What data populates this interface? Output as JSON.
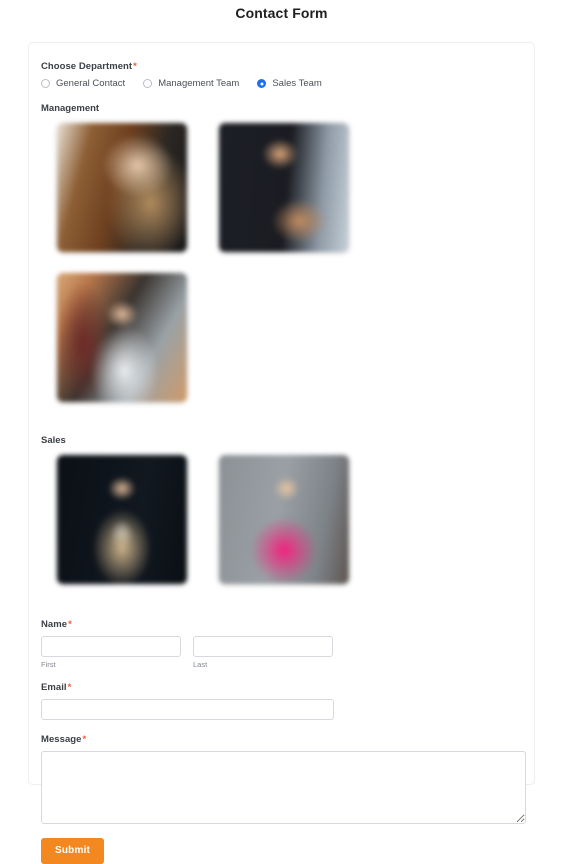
{
  "page": {
    "title": "Contact Form"
  },
  "form": {
    "department": {
      "label": "Choose Department",
      "required_marker": "*",
      "options": [
        {
          "label": "General Contact",
          "selected": false
        },
        {
          "label": "Management Team",
          "selected": false
        },
        {
          "label": "Sales Team",
          "selected": true
        }
      ]
    },
    "groups": [
      {
        "heading": "Management",
        "choices": [
          {
            "caption": "",
            "caption_state": "blurred",
            "photo": "ph1"
          },
          {
            "caption": "",
            "caption_state": "blurred",
            "photo": "ph2"
          },
          {
            "caption": "",
            "caption_state": "blurred",
            "photo": "ph3"
          }
        ]
      },
      {
        "heading": "Sales",
        "choices": [
          {
            "caption": "",
            "caption_state": "blurred",
            "photo": "ph4"
          },
          {
            "caption": "",
            "caption_state": "blurred",
            "photo": "ph5"
          }
        ]
      }
    ],
    "name": {
      "label": "Name",
      "required_marker": "*",
      "first": {
        "value": "",
        "placeholder": "",
        "sub_label": "First"
      },
      "last": {
        "value": "",
        "placeholder": "",
        "sub_label": "Last"
      }
    },
    "email": {
      "label": "Email",
      "required_marker": "*",
      "value": "",
      "placeholder": ""
    },
    "message": {
      "label": "Message",
      "required_marker": "*",
      "value": "",
      "placeholder": ""
    },
    "submit": {
      "label": "Submit"
    }
  },
  "colors": {
    "required": "#f25c3b",
    "radio_selected": "#1b6ef3",
    "submit_bg": "#f2881f",
    "card_border": "#eceef0",
    "input_border": "#d6dade",
    "label_text": "#3b4046"
  }
}
